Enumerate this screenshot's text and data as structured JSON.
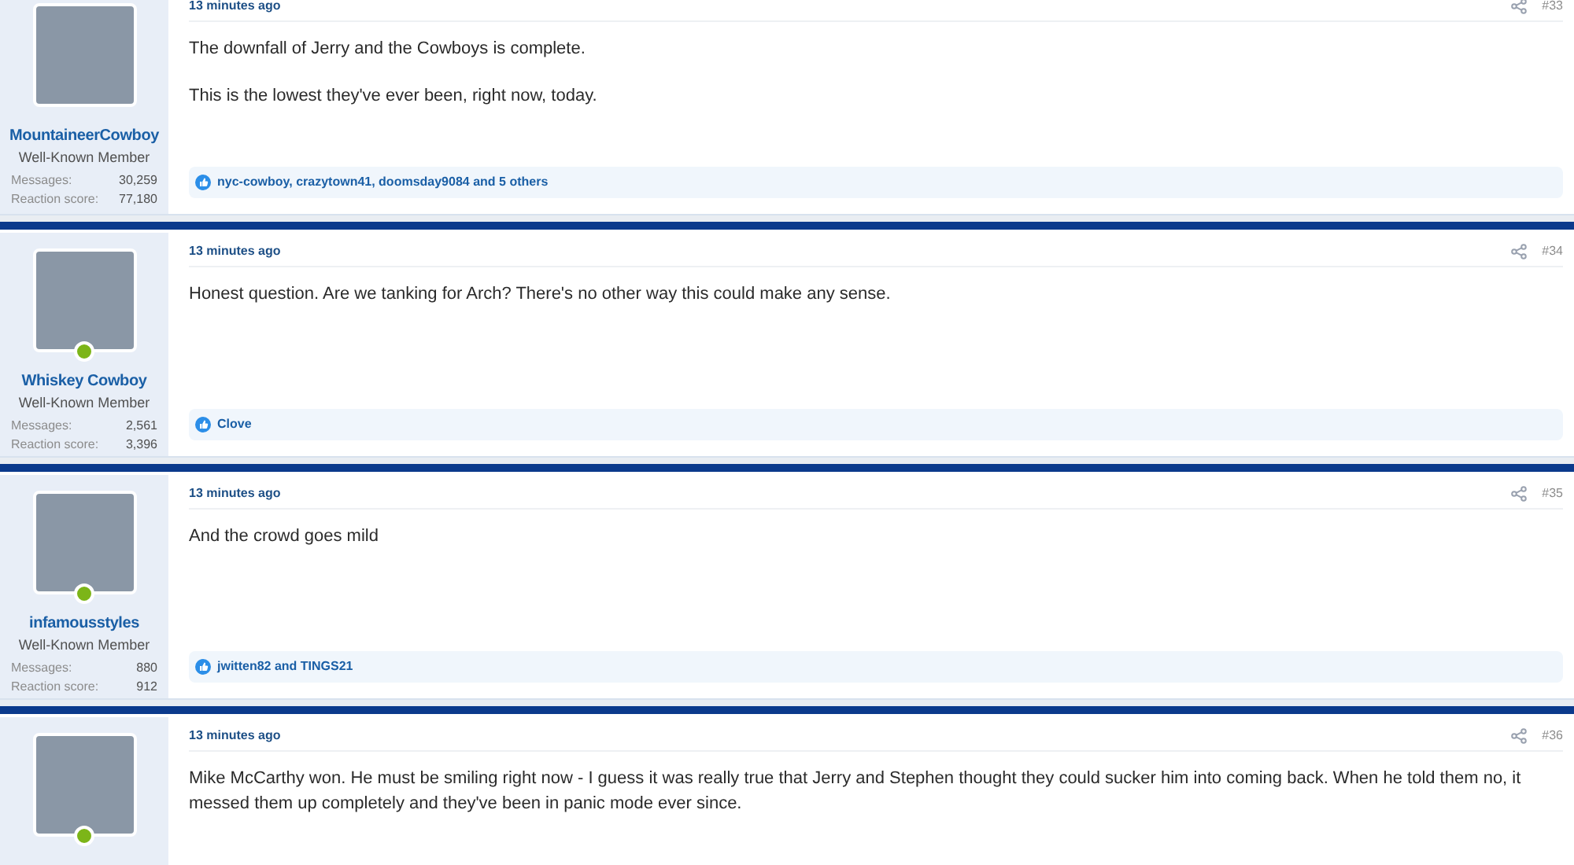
{
  "posts": [
    {
      "user": "MountaineerCowboy",
      "role": "Well-Known Member",
      "online": false,
      "messages_label": "Messages:",
      "messages": "30,259",
      "score_label": "Reaction score:",
      "score": "77,180",
      "time": "13 minutes ago",
      "number": "#33",
      "paragraphs": [
        "The downfall of Jerry and the Cowboys is complete.",
        "This is the lowest they've ever been, right now, today."
      ],
      "reactions": "nyc-cowboy, crazytown41, doomsday9084 and 5 others"
    },
    {
      "user": "Whiskey Cowboy",
      "role": "Well-Known Member",
      "online": true,
      "messages_label": "Messages:",
      "messages": "2,561",
      "score_label": "Reaction score:",
      "score": "3,396",
      "time": "13 minutes ago",
      "number": "#34",
      "paragraphs": [
        "Honest question. Are we tanking for Arch? There's no other way this could make any sense."
      ],
      "reactions": "Clove"
    },
    {
      "user": "infamousstyles",
      "role": "Well-Known Member",
      "online": true,
      "messages_label": "Messages:",
      "messages": "880",
      "score_label": "Reaction score:",
      "score": "912",
      "time": "13 minutes ago",
      "number": "#35",
      "paragraphs": [
        "And the crowd goes mild"
      ],
      "reactions": "jwitten82 and TINGS21"
    },
    {
      "online": true,
      "time": "13 minutes ago",
      "number": "#36",
      "paragraphs": [
        "Mike McCarthy won. He must be smiling right now - I guess it was really true that Jerry and Stephen thought they could sucker him into coming back. When he told them no, it messed them up completely and they've been in panic mode ever since."
      ]
    }
  ]
}
